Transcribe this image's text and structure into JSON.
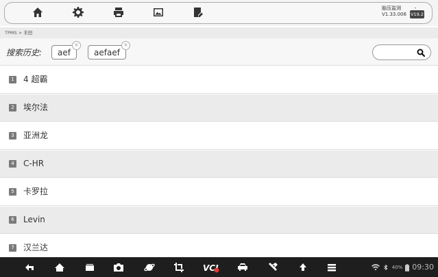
{
  "toolbar": {
    "icons": [
      "home-icon",
      "gear-icon",
      "printer-icon",
      "image-icon",
      "report-icon"
    ],
    "app_title": "胎压监测",
    "app_version": "V1.33.006",
    "battery_terminals": "- +",
    "battery_label": "V19.2"
  },
  "breadcrumb": "TPMS > 丰田",
  "search": {
    "history_label": "搜索历史:",
    "history": [
      "aef",
      "aefaef"
    ],
    "placeholder": ""
  },
  "list": {
    "items": [
      {
        "num": "1",
        "label": "4 超霸"
      },
      {
        "num": "2",
        "label": "埃尔法"
      },
      {
        "num": "3",
        "label": "亚洲龙"
      },
      {
        "num": "4",
        "label": "C-HR"
      },
      {
        "num": "5",
        "label": "卡罗拉"
      },
      {
        "num": "6",
        "label": "Levin"
      },
      {
        "num": "7",
        "label": "汉兰达"
      }
    ]
  },
  "navbar": {
    "icons": [
      "back-icon",
      "home-icon",
      "recent-apps-icon",
      "camera-icon",
      "browser-icon",
      "crop-icon",
      "vci-icon",
      "car-icon",
      "tools-icon",
      "upload-icon",
      "menu-icon"
    ],
    "battery_percent": "40%",
    "time": "09:30",
    "vci_badge_color": "#e53935"
  }
}
